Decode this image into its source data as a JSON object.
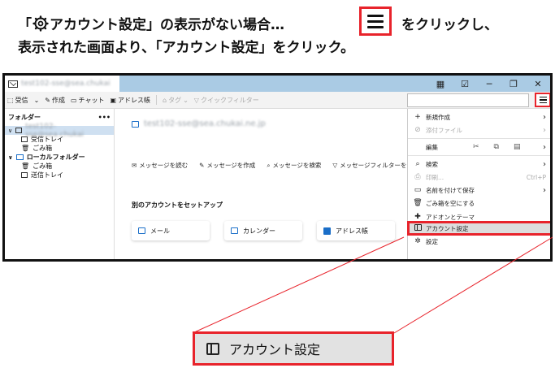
{
  "instruction": {
    "line1_pre": "「",
    "line1_gear_icon": "gear-icon",
    "line1_mid": "アカウント設定」の表示がない場合…",
    "line1_post": "をクリックし、",
    "line2": "表示された画面より、「アカウント設定」をクリック。"
  },
  "colors": {
    "highlight": "#e8232b",
    "accent": "#1a6ec8",
    "titlebar_active": "#aacbe4"
  },
  "titlebar": {
    "account_blur": "test102-sse@sea.chukai"
  },
  "toolbar": {
    "receive": "受信",
    "compose": "作成",
    "chat": "チャット",
    "addressbook": "アドレス帳",
    "tag": "タグ",
    "quickfilter": "クイックフィルター"
  },
  "folders": {
    "title": "フォルダー",
    "more": "•••",
    "account": "test102-sse@sea.chukai",
    "items": [
      "受信トレイ",
      "ごみ箱"
    ],
    "local": "ローカルフォルダー",
    "local_items": [
      "ごみ箱",
      "送信トレイ"
    ]
  },
  "main": {
    "account_email": "test102-sse@sea.chukai.ne.jp",
    "actions": [
      "メッセージを読む",
      "メッセージを作成",
      "メッセージを検索",
      "メッセージフィルターを"
    ],
    "setup_title": "別のアカウントをセットアップ",
    "cards": [
      "メール",
      "カレンダー",
      "アドレス帳"
    ]
  },
  "appmenu": {
    "new": "新規作成",
    "attach": "添付ファイル",
    "edit": "編集",
    "search": "検索",
    "print": "印刷...",
    "print_shortcut": "Ctrl+P",
    "save_as": "名前を付けて保存",
    "empty_trash": "ごみ箱を空にする",
    "addons": "アドオンとテーマ",
    "account_settings": "アカウント設定",
    "settings": "設定"
  },
  "zoom": {
    "label": "アカウント設定"
  }
}
